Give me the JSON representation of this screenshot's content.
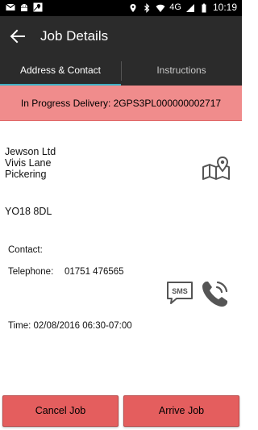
{
  "status_bar": {
    "network": "4G",
    "time": "10:19",
    "icons": [
      "gmail-icon",
      "android-icon",
      "maps-icon",
      "location-icon",
      "bluetooth-icon",
      "wifi-icon",
      "signal-icon",
      "battery-icon"
    ]
  },
  "app_bar": {
    "title": "Job Details",
    "back_icon": "arrow-back-icon"
  },
  "tabs": [
    {
      "label": "Address & Contact",
      "active": true
    },
    {
      "label": "Instructions",
      "active": false
    }
  ],
  "banner": {
    "text": "In Progress Delivery: 2GPS3PL000000002717"
  },
  "address": {
    "lines": [
      "Jewson Ltd",
      "Vivis Lane",
      "Pickering"
    ],
    "postcode": "YO18 8DL"
  },
  "contact": {
    "contact_label": "Contact:",
    "telephone_label": "Telephone:",
    "telephone_value": "01751 476565",
    "time": "Time: 02/08/2016 06:30-07:00"
  },
  "actions": {
    "map_icon": "map-pin-icon",
    "sms_label": "SMS",
    "call_icon": "phone-call-icon",
    "cancel_label": "Cancel Job",
    "arrive_label": "Arrive Job"
  },
  "colors": {
    "app_bar": "#2b2b2b",
    "tab_indicator": "#3fb0c4",
    "banner": "#f08c8c",
    "button": "#e45e5e"
  }
}
